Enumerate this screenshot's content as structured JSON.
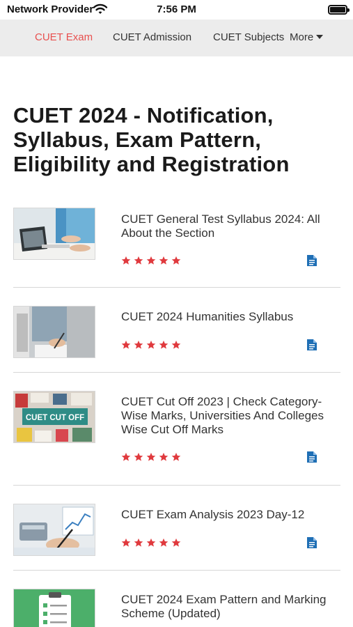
{
  "status_bar": {
    "provider": "Network Provider",
    "time": "7:56 PM"
  },
  "nav": {
    "tabs": [
      {
        "label": "CUET Exam",
        "active": true
      },
      {
        "label": "CUET Admission",
        "active": false
      },
      {
        "label": "CUET Subjects",
        "active": false
      }
    ],
    "more_label": "More"
  },
  "page_title": "CUET 2024 - Notification, Syllabus, Exam Pattern, Eligibility and Registration",
  "articles": [
    {
      "title": "CUET General Test Syllabus 2024: All About the Section",
      "rating": 5,
      "thumbnail": "laptop-study-photo"
    },
    {
      "title": "CUET 2024 Humanities Syllabus",
      "rating": 5,
      "thumbnail": "writing-desk-photo"
    },
    {
      "title": "CUET Cut Off 2023 | Check Category-Wise Marks, Universities And Colleges Wise Cut Off Marks",
      "rating": 5,
      "thumbnail": "cuet-cut-off-banner",
      "thumbnail_text": "CUET CUT OFF"
    },
    {
      "title": "CUET Exam Analysis 2023 Day-12",
      "rating": 5,
      "thumbnail": "calculator-chart-photo"
    },
    {
      "title": "CUET 2024 Exam Pattern and Marking Scheme (Updated)",
      "rating": 5,
      "thumbnail": "clipboard-checklist-illustration"
    }
  ],
  "colors": {
    "accent": "#e8504f",
    "star": "#e03a3e",
    "doc_icon": "#1f6fb5",
    "nav_bg": "#ececec"
  }
}
